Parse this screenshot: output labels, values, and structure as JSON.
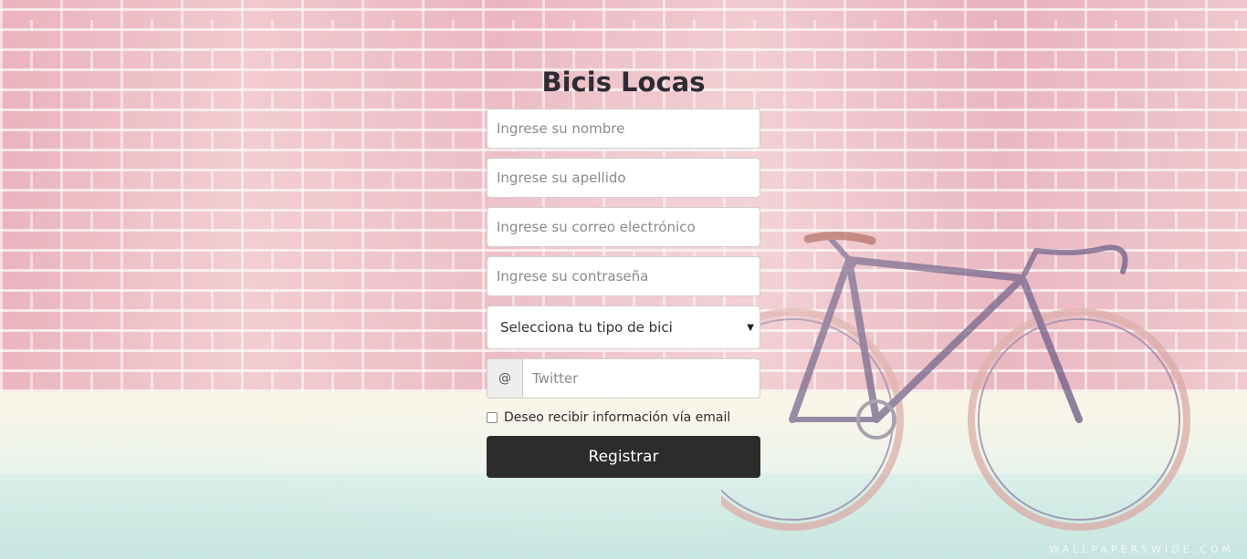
{
  "page": {
    "title": "Bicis Locas",
    "watermark": "WALLPAPERSWIDE.COM"
  },
  "form": {
    "first_name_placeholder": "Ingrese su nombre",
    "last_name_placeholder": "Ingrese su apellido",
    "email_placeholder": "Ingrese su correo electrónico",
    "password_placeholder": "Ingrese su contraseña",
    "bike_type": {
      "selected": "Selecciona tu tipo de bici"
    },
    "twitter": {
      "addon": "@",
      "placeholder": "Twitter"
    },
    "newsletter_label": "Deseo recibir información vía email",
    "newsletter_checked": false,
    "submit_label": "Registrar"
  },
  "icons": {
    "select_caret": "chevron-down-icon"
  },
  "colors": {
    "title": "#2f2b33",
    "button_bg": "#2d2c2c",
    "button_text": "#ffffff"
  }
}
